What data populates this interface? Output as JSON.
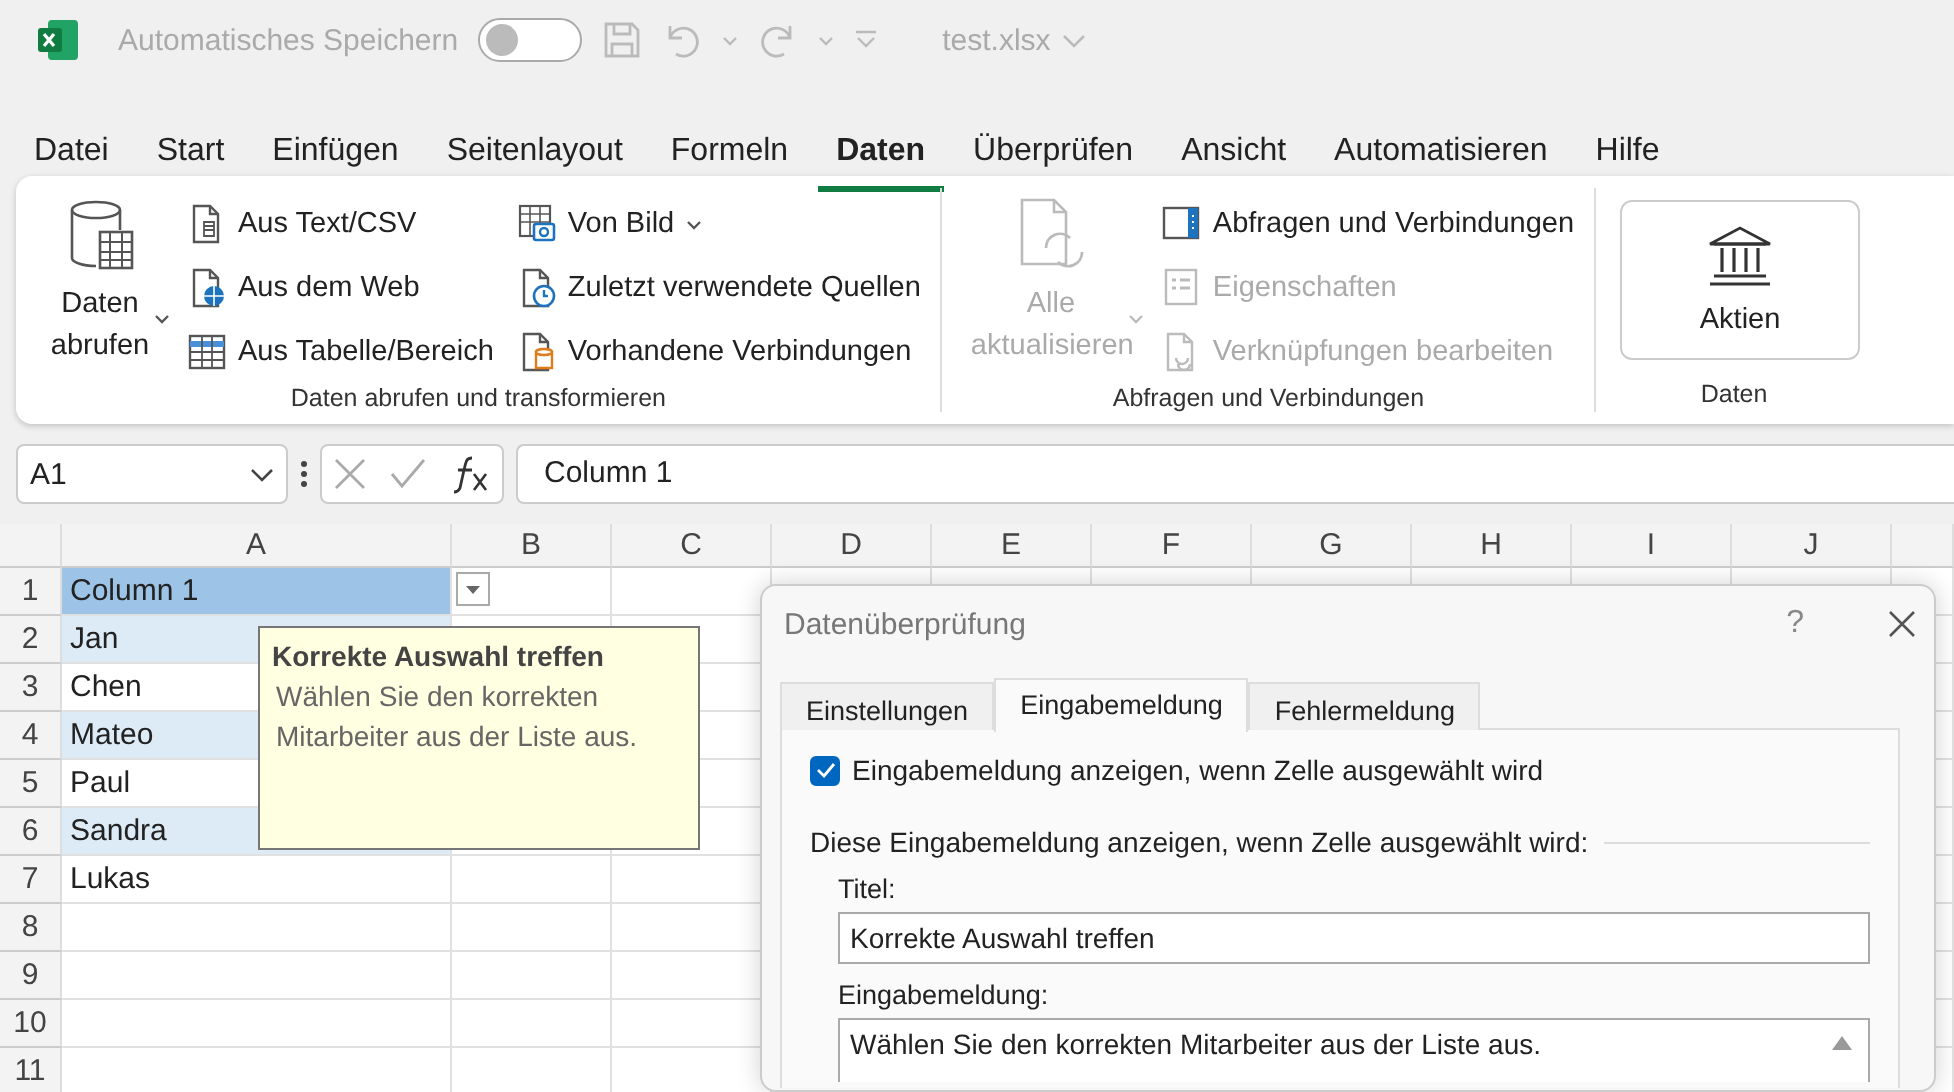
{
  "title_bar": {
    "autosave_label": "Automatisches Speichern",
    "autosave_on": false,
    "file_name": "test.xlsx"
  },
  "menu": [
    {
      "label": "Datei",
      "selected": false
    },
    {
      "label": "Start",
      "selected": false
    },
    {
      "label": "Einfügen",
      "selected": false
    },
    {
      "label": "Seitenlayout",
      "selected": false
    },
    {
      "label": "Formeln",
      "selected": false
    },
    {
      "label": "Daten",
      "selected": true
    },
    {
      "label": "Überprüfen",
      "selected": false
    },
    {
      "label": "Ansicht",
      "selected": false
    },
    {
      "label": "Automatisieren",
      "selected": false
    },
    {
      "label": "Hilfe",
      "selected": false
    }
  ],
  "ribbon": {
    "groups": [
      {
        "title": "Daten abrufen und transformieren",
        "large": {
          "label": "Daten abrufen",
          "dropdown": true,
          "disabled": false
        },
        "columns": [
          [
            {
              "label": "Aus Text/CSV",
              "dropdown": false,
              "disabled": false
            },
            {
              "label": "Aus dem Web",
              "dropdown": false,
              "disabled": false
            },
            {
              "label": "Aus Tabelle/Bereich",
              "dropdown": false,
              "disabled": false
            }
          ],
          [
            {
              "label": "Von Bild",
              "dropdown": true,
              "disabled": false
            },
            {
              "label": "Zuletzt verwendete Quellen",
              "dropdown": false,
              "disabled": false
            },
            {
              "label": "Vorhandene Verbindungen",
              "dropdown": false,
              "disabled": false
            }
          ]
        ]
      },
      {
        "title": "Abfragen und Verbindungen",
        "large": {
          "label": "Alle aktualisieren",
          "dropdown": true,
          "disabled": true
        },
        "columns": [
          [
            {
              "label": "Abfragen und Verbindungen",
              "dropdown": false,
              "disabled": false
            },
            {
              "label": "Eigenschaften",
              "dropdown": false,
              "disabled": true
            },
            {
              "label": "Verknüpfungen bearbeiten",
              "dropdown": false,
              "disabled": true
            }
          ]
        ]
      },
      {
        "title": "Daten",
        "tiles": [
          {
            "label": "Aktien"
          }
        ]
      }
    ]
  },
  "formula_bar": {
    "name_box": "A1",
    "formula": "Column 1"
  },
  "sheet": {
    "columns": [
      "A",
      "B",
      "C",
      "D",
      "E",
      "F",
      "G",
      "H",
      "I",
      "J"
    ],
    "rows": [
      {
        "number": "1",
        "cell_a": {
          "text": "Column 1",
          "kind": "header"
        },
        "validation_dropdown": true
      },
      {
        "number": "2",
        "cell_a": {
          "text": "Jan",
          "kind": "band"
        }
      },
      {
        "number": "3",
        "cell_a": {
          "text": "Chen",
          "kind": "plain"
        }
      },
      {
        "number": "4",
        "cell_a": {
          "text": "Mateo",
          "kind": "band"
        }
      },
      {
        "number": "5",
        "cell_a": {
          "text": "Paul",
          "kind": "plain"
        }
      },
      {
        "number": "6",
        "cell_a": {
          "text": "Sandra",
          "kind": "band"
        }
      },
      {
        "number": "7",
        "cell_a": {
          "text": "Lukas",
          "kind": "plain"
        }
      },
      {
        "number": "8"
      },
      {
        "number": "9"
      },
      {
        "number": "10"
      },
      {
        "number": "11"
      }
    ]
  },
  "input_tooltip": {
    "title": "Korrekte Auswahl treffen",
    "text": "Wählen Sie den korrekten Mitarbeiter aus der Liste aus."
  },
  "dialog": {
    "title": "Datenüberprüfung",
    "help": "?",
    "tabs": [
      {
        "label": "Einstellungen",
        "selected": false
      },
      {
        "label": "Eingabemeldung",
        "selected": true
      },
      {
        "label": "Fehlermeldung",
        "selected": false
      }
    ],
    "show_message": {
      "label": "Eingabemeldung anzeigen, wenn Zelle ausgewählt wird",
      "checked": true
    },
    "section_label": "Diese Eingabemeldung anzeigen, wenn Zelle ausgewählt wird:",
    "title_field": {
      "label": "Titel:",
      "value": "Korrekte Auswahl treffen"
    },
    "message_field": {
      "label": "Eingabemeldung:",
      "value": "Wählen Sie den korrekten Mitarbeiter aus der Liste aus."
    }
  }
}
